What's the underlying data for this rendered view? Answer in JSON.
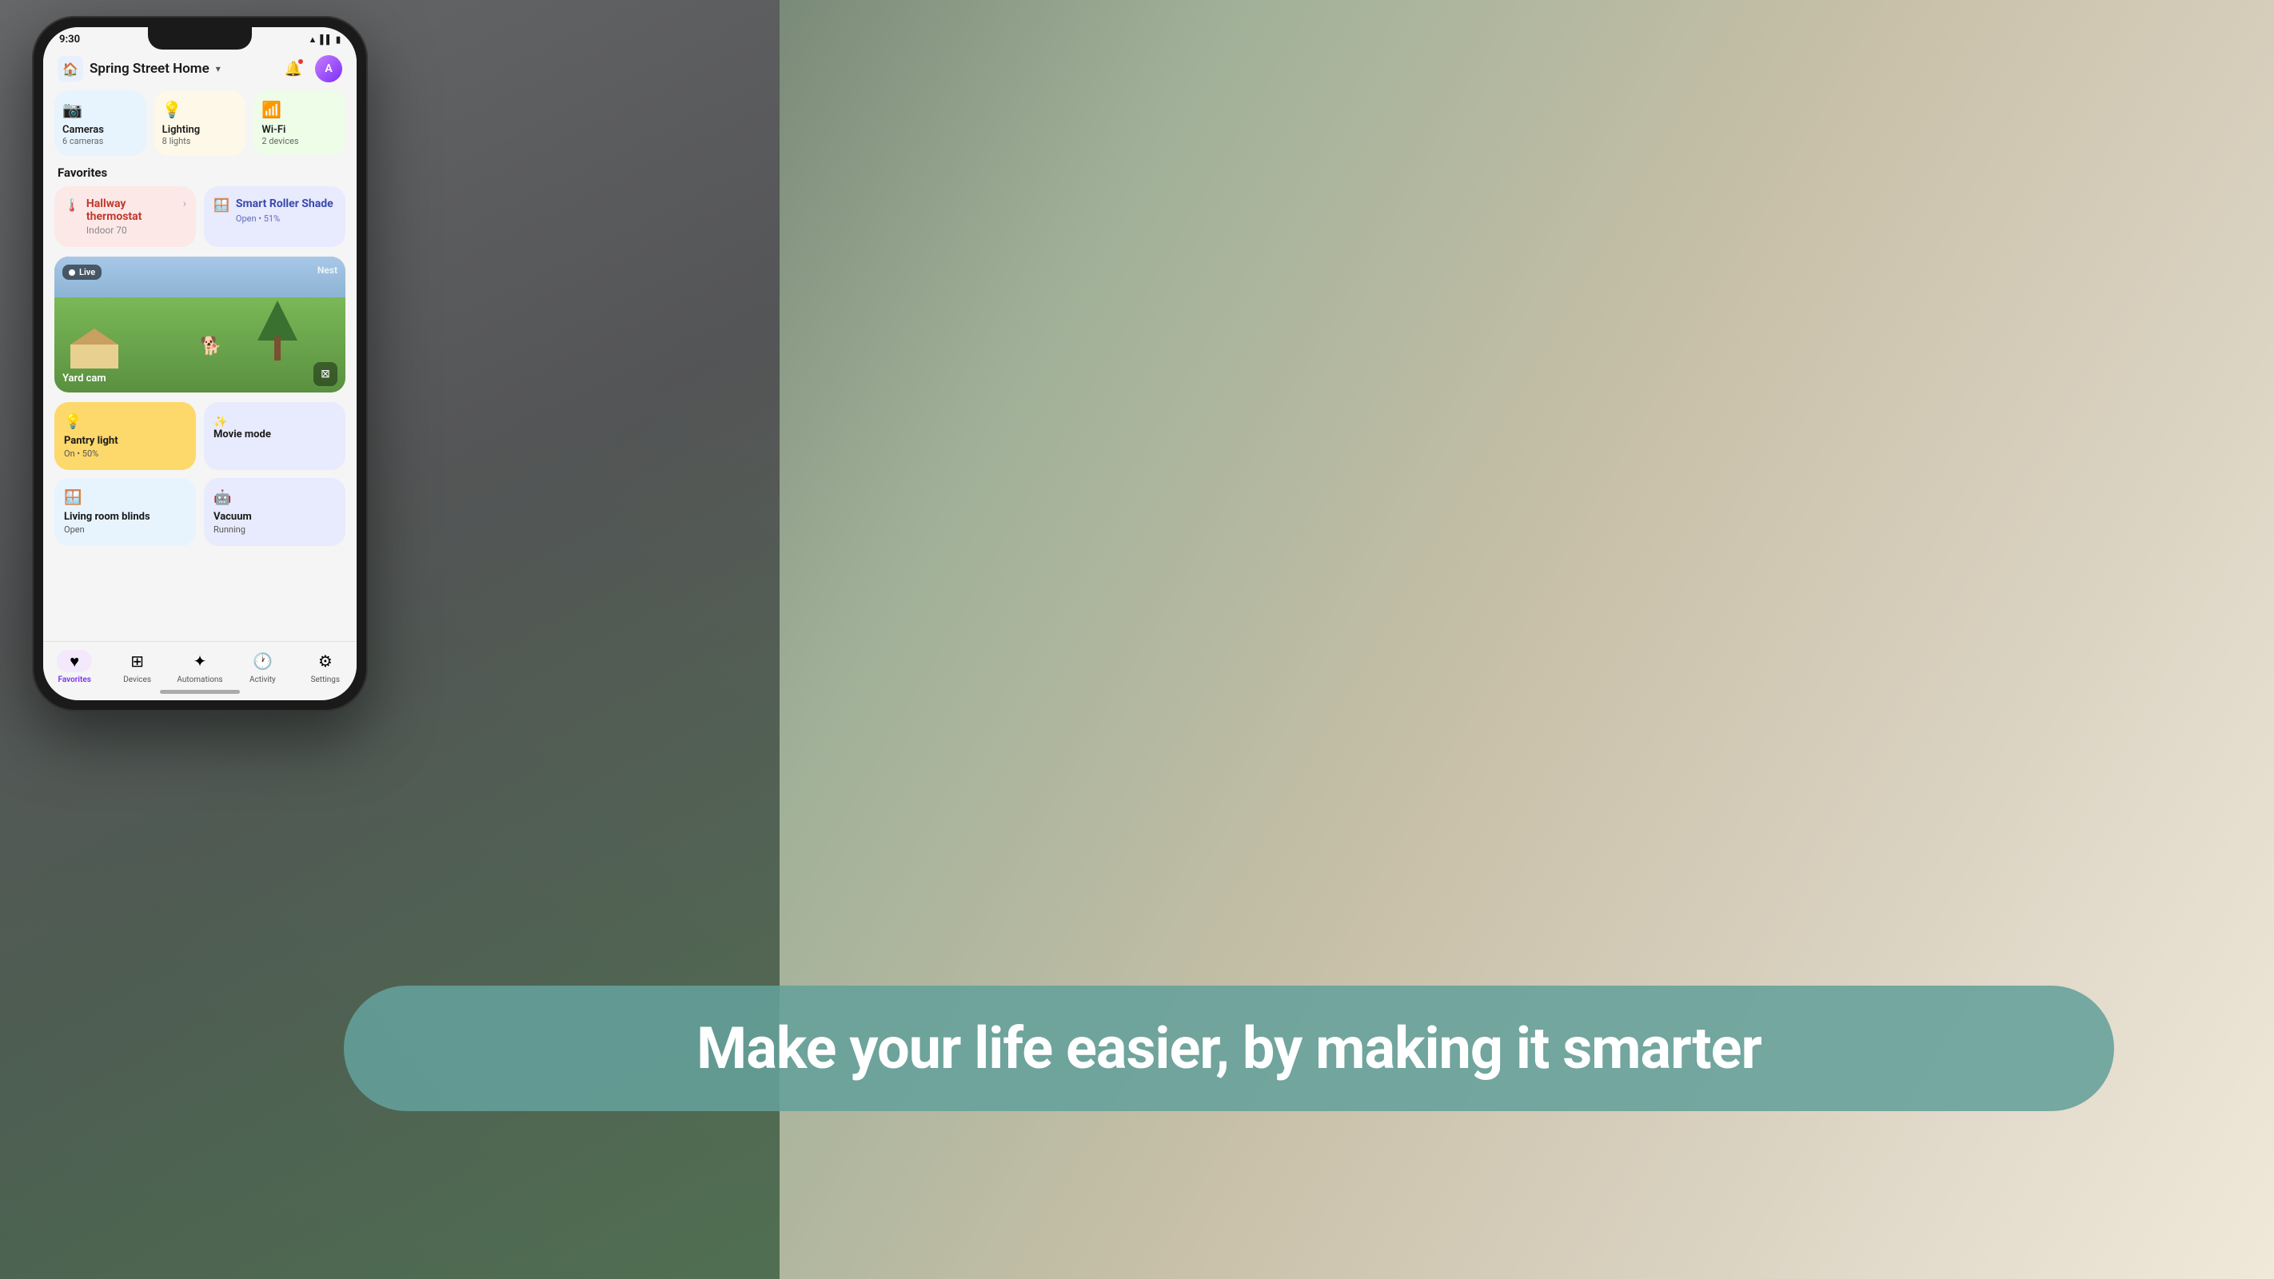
{
  "background": {
    "tagline": "Make your life easier, by making it smarter"
  },
  "phone": {
    "status_bar": {
      "time": "9:30",
      "wifi_icon": "wifi",
      "signal_icon": "signal",
      "battery_icon": "battery"
    },
    "header": {
      "home_icon": "🏠",
      "home_name": "Spring Street Home",
      "chevron": "▾",
      "notification_icon": "🔔",
      "avatar_initials": "A"
    },
    "categories": [
      {
        "id": "cameras",
        "icon": "📷",
        "name": "Cameras",
        "count": "6 cameras",
        "bg": "cameras"
      },
      {
        "id": "lighting",
        "icon": "💡",
        "name": "Lighting",
        "count": "8 lights",
        "bg": "lighting"
      },
      {
        "id": "wifi",
        "icon": "📶",
        "name": "Wi-Fi",
        "count": "2 devices",
        "bg": "wifi"
      }
    ],
    "favorites_label": "Favorites",
    "favorites": [
      {
        "id": "thermostat",
        "icon": "🌡️",
        "title": "Hallway thermostat",
        "subtitle": "Indoor 70",
        "type": "thermostat"
      },
      {
        "id": "roller-shade",
        "icon": "🪟",
        "title": "Smart Roller Shade",
        "detail": "Open • 51%",
        "type": "roller-shade"
      }
    ],
    "camera_feed": {
      "is_live": true,
      "live_label": "Live",
      "brand": "Nest",
      "label": "Yard cam",
      "mute_icon": "🔇"
    },
    "devices_row1": [
      {
        "id": "pantry-light",
        "icon": "💡",
        "name": "Pantry light",
        "status": "On • 50%",
        "type": "pantry-light"
      },
      {
        "id": "movie-mode",
        "icon": "✨",
        "name": "Movie mode",
        "status": "",
        "type": "movie-mode"
      }
    ],
    "devices_row2": [
      {
        "id": "blinds",
        "icon": "🪟",
        "name": "Living room blinds",
        "status": "Open",
        "type": "blinds"
      },
      {
        "id": "vacuum",
        "icon": "🤖",
        "name": "Vacuum",
        "status": "Running",
        "type": "vacuum"
      }
    ],
    "nav": [
      {
        "id": "favorites",
        "icon": "♥",
        "label": "Favorites",
        "active": true
      },
      {
        "id": "devices",
        "icon": "⊞",
        "label": "Devices",
        "active": false
      },
      {
        "id": "automations",
        "icon": "✦",
        "label": "Automations",
        "active": false
      },
      {
        "id": "activity",
        "icon": "🕐",
        "label": "Activity",
        "active": false
      },
      {
        "id": "settings",
        "icon": "⚙",
        "label": "Settings",
        "active": false
      }
    ]
  }
}
